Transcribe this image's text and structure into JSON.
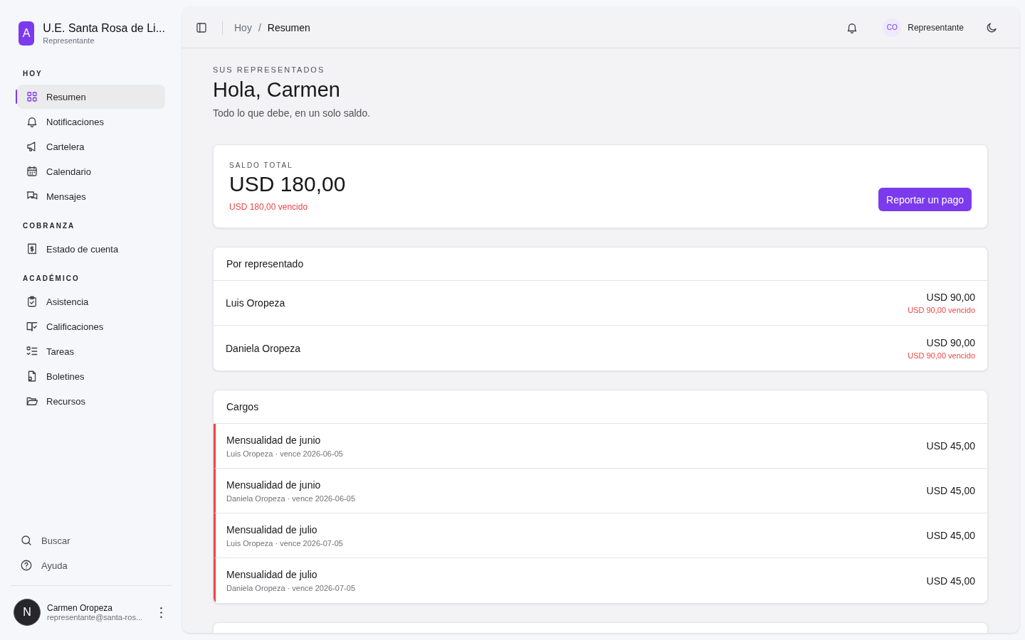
{
  "brand": {
    "logo": "A",
    "name": "U.E. Santa Rosa de Li...",
    "role": "Representante"
  },
  "sidebar": {
    "sections": [
      {
        "title": "HOY",
        "items": [
          {
            "label": "Resumen",
            "selected": true
          },
          {
            "label": "Notificaciones",
            "selected": false
          },
          {
            "label": "Cartelera",
            "selected": false
          },
          {
            "label": "Calendario",
            "selected": false
          },
          {
            "label": "Mensajes",
            "selected": false
          }
        ]
      },
      {
        "title": "COBRANZA",
        "items": [
          {
            "label": "Estado de cuenta",
            "selected": false
          }
        ]
      },
      {
        "title": "ACADÉMICO",
        "items": [
          {
            "label": "Asistencia",
            "selected": false
          },
          {
            "label": "Calificaciones",
            "selected": false
          },
          {
            "label": "Tareas",
            "selected": false
          },
          {
            "label": "Boletines",
            "selected": false
          },
          {
            "label": "Recursos",
            "selected": false
          }
        ]
      }
    ],
    "footer_items": [
      {
        "label": "Buscar"
      },
      {
        "label": "Ayuda"
      }
    ],
    "user": {
      "avatar": "N",
      "name": "Carmen Oropeza",
      "email": "representante@santa-ros..."
    }
  },
  "topbar": {
    "breadcrumb": [
      "Hoy",
      "Resumen"
    ],
    "breadcrumb_separator": "/",
    "user_initials": "CO",
    "user_role": "Representante"
  },
  "header": {
    "eyebrow": "SUS REPRESENTADOS",
    "title": "Hola, Carmen",
    "subtitle": "Todo lo que debe, en un solo saldo."
  },
  "balance": {
    "label": "SALDO TOTAL",
    "amount": "USD 180,00",
    "overdue": "USD 180,00 vencido",
    "button": "Reportar un pago"
  },
  "by_student": {
    "title": "Por representado",
    "rows": [
      {
        "name": "Luis Oropeza",
        "amount": "USD 90,00",
        "overdue": "USD 90,00 vencido"
      },
      {
        "name": "Daniela Oropeza",
        "amount": "USD 90,00",
        "overdue": "USD 90,00 vencido"
      }
    ]
  },
  "charges": {
    "title": "Cargos",
    "rows": [
      {
        "title": "Mensualidad de junio",
        "detail": "Luis Oropeza · vence 2026-06-05",
        "amount": "USD 45,00",
        "overdue": true
      },
      {
        "title": "Mensualidad de junio",
        "detail": "Daniela Oropeza · vence 2026-06-05",
        "amount": "USD 45,00",
        "overdue": true
      },
      {
        "title": "Mensualidad de julio",
        "detail": "Luis Oropeza · vence 2026-07-05",
        "amount": "USD 45,00",
        "overdue": true
      },
      {
        "title": "Mensualidad de julio",
        "detail": "Daniela Oropeza · vence 2026-07-05",
        "amount": "USD 45,00",
        "overdue": true
      }
    ]
  }
}
